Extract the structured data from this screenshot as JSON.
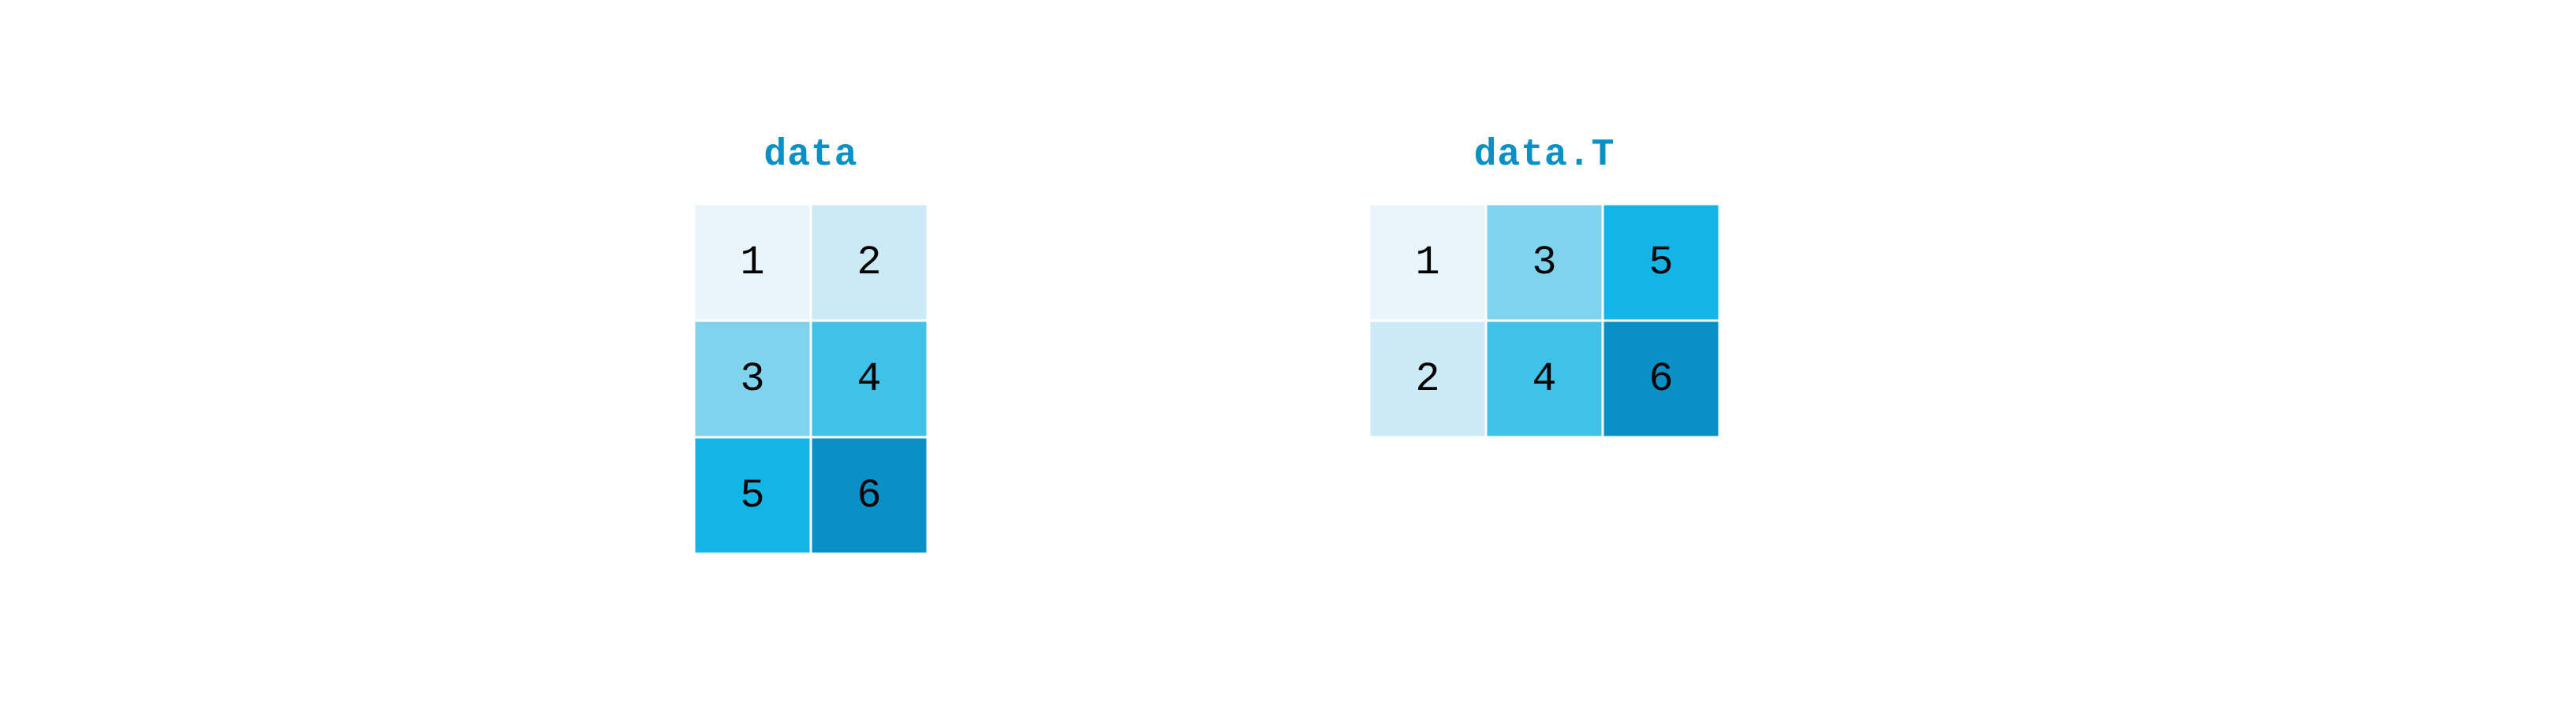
{
  "left": {
    "title": "data",
    "rows": [
      [
        1,
        2
      ],
      [
        3,
        4
      ],
      [
        5,
        6
      ]
    ]
  },
  "right": {
    "title": "data.T",
    "rows": [
      [
        1,
        3,
        5
      ],
      [
        2,
        4,
        6
      ]
    ]
  },
  "shades": {
    "1": "#e8f6fb",
    "2": "#cbeaf6",
    "3": "#7fd3ed",
    "4": "#40c1e8",
    "5": "#13b5e6",
    "6": "#0890c7"
  }
}
